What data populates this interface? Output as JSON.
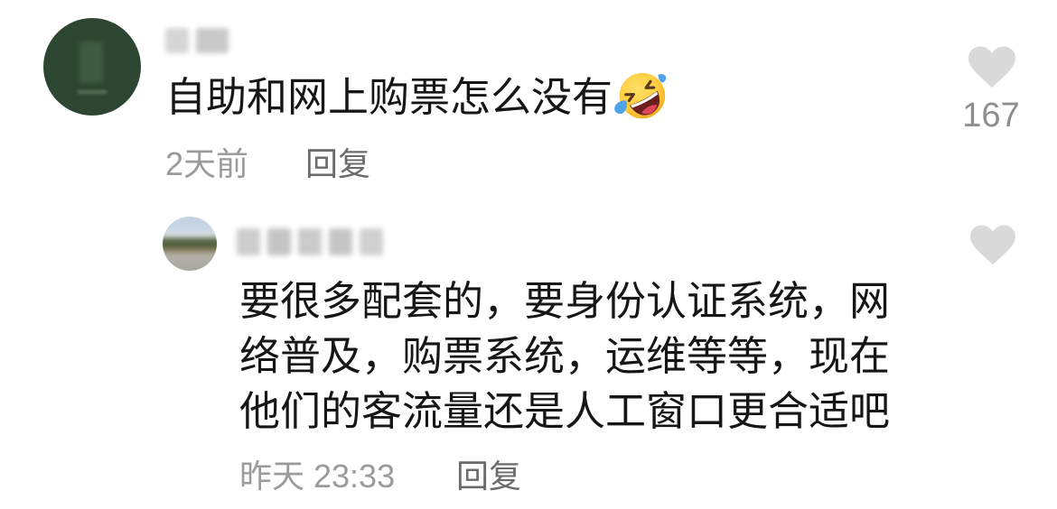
{
  "colors": {
    "text": "#161616",
    "meta": "#9b9b9b",
    "action": "#6b6b6b",
    "like": "#d9d9d9",
    "count": "#8e8e8e",
    "avatar_main": "#2d4631"
  },
  "comment": {
    "avatar_icon": "user-avatar",
    "text": "自助和网上购票怎么没有",
    "emoji_icon": "rolling-on-the-floor-laughing-emoji",
    "time": "2天前",
    "reply_label": "回复",
    "like_icon": "heart-icon",
    "like_count": "167"
  },
  "reply": {
    "avatar_icon": "user-avatar",
    "text_lines": [
      "要很多配套的，要身份认证系统，网",
      "络普及，购票系统，运维等等，现在",
      "他们的客流量还是人工窗口更合适吧"
    ],
    "time": "昨天 23:33",
    "reply_label": "回复",
    "like_icon": "heart-icon"
  }
}
